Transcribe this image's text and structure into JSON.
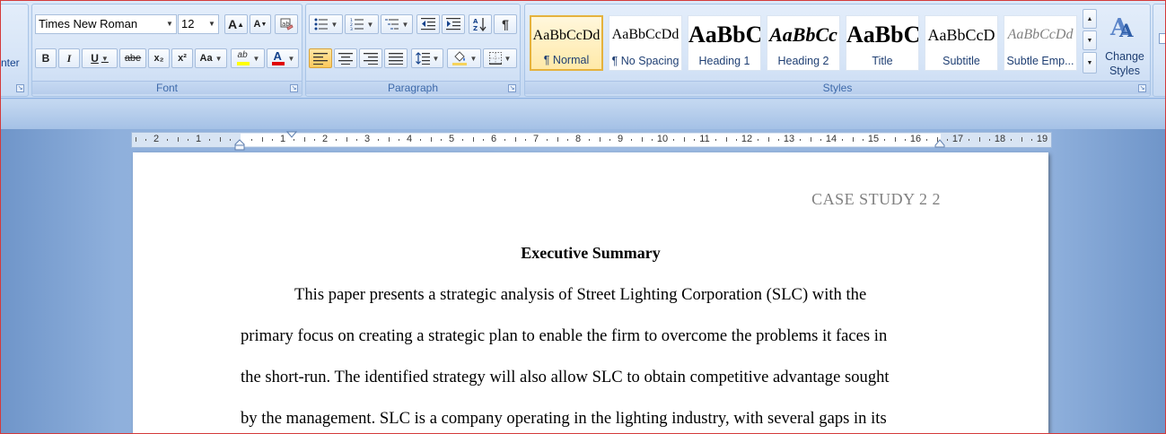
{
  "font_group": {
    "label": "Font",
    "font_name": "Times New Roman",
    "font_size": "12",
    "clipped_left_label": "nter",
    "grow_font": "A",
    "shrink_font": "A",
    "bold": "B",
    "italic": "I",
    "underline": "U",
    "strikethrough": "abe",
    "subscript": "x₂",
    "superscript": "x²",
    "change_case": "Aa",
    "highlight": "ab",
    "font_color": "A"
  },
  "paragraph_group": {
    "label": "Paragraph"
  },
  "styles_group": {
    "label": "Styles",
    "styles": [
      {
        "sample": "AaBbCcDd",
        "name": "¶ Normal",
        "selected": true
      },
      {
        "sample": "AaBbCcDd",
        "name": "¶ No Spacing",
        "selected": false
      },
      {
        "sample": "AaBbC",
        "name": "Heading 1",
        "selected": false
      },
      {
        "sample": "AaBbCc",
        "name": "Heading 2",
        "selected": false
      },
      {
        "sample": "AaBbC",
        "name": "Title",
        "selected": false
      },
      {
        "sample": "AaBbCcD",
        "name": "Subtitle",
        "selected": false
      },
      {
        "sample": "AaBbCcDd",
        "name": "Subtle Emp...",
        "selected": false
      }
    ],
    "change_styles": "Change Styles"
  },
  "ruler": {
    "labels": [
      "2",
      "1",
      "1",
      "2",
      "3",
      "4",
      "5",
      "6",
      "7",
      "8",
      "9",
      "10",
      "11",
      "12",
      "13",
      "14",
      "15",
      "16",
      "17",
      "18",
      "19"
    ]
  },
  "document": {
    "header": "CASE STUDY 2 2",
    "title": "Executive Summary",
    "lines": [
      "This paper presents a strategic analysis of Street Lighting Corporation (SLC) with the",
      "primary focus on creating a strategic plan to enable the firm to overcome the problems it faces in",
      "the short-run. The identified strategy will also allow SLC to obtain competitive advantage sought",
      "by the management.  SLC is a company operating in the lighting industry, with several gaps in its"
    ]
  },
  "colors": {
    "highlight_bar": "#ffff00",
    "font_color_bar": "#ff0000",
    "selected_style": "#fbc95c"
  }
}
